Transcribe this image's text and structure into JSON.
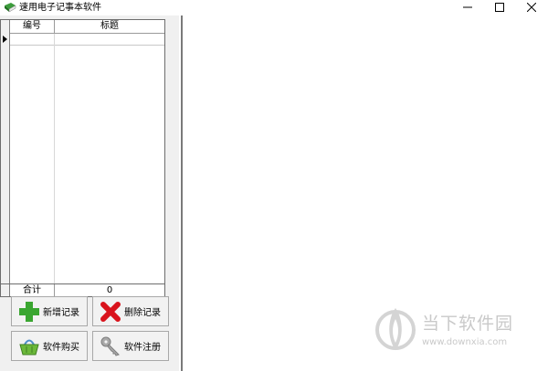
{
  "window": {
    "title": "速用电子记事本软件"
  },
  "grid": {
    "columns": [
      "编号",
      "标题"
    ],
    "footer_label": "合计",
    "footer_count": "0"
  },
  "buttons": {
    "add": "新增记录",
    "delete": "删除记录",
    "buy": "软件购买",
    "register": "软件注册"
  },
  "watermark": {
    "name": "当下软件园",
    "url": "www.downxia.com"
  },
  "icons": {
    "app": "book-icon",
    "add": "plus-icon",
    "delete": "x-icon",
    "buy": "basket-icon",
    "register": "key-icon"
  },
  "colors": {
    "add_icon": "#3aa631",
    "delete_icon": "#d9131c",
    "buy_icon": "#6bb83a",
    "register_icon": "#9a9a9a"
  }
}
